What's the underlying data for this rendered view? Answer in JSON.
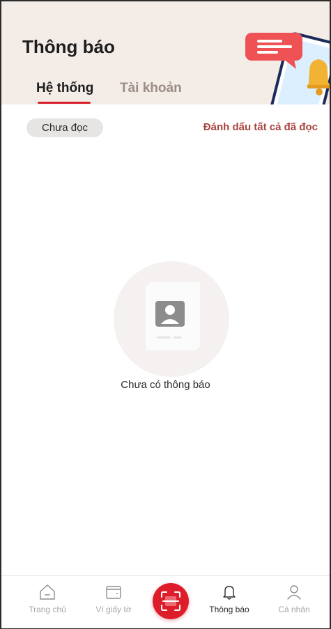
{
  "header": {
    "title": "Thông báo",
    "tabs": [
      {
        "label": "Hệ thống",
        "active": true
      },
      {
        "label": "Tài khoản",
        "active": false
      }
    ],
    "illustration_icons": [
      "chat-bubble-icon",
      "bell-icon"
    ]
  },
  "filter": {
    "unread_label": "Chưa đọc",
    "mark_all_label": "Đánh dấu tất cả đã đọc"
  },
  "empty_state": {
    "icon": "profile-card-icon",
    "message": "Chưa có thông báo"
  },
  "bottom_nav": {
    "items": [
      {
        "label": "Trang chủ",
        "icon": "home-icon"
      },
      {
        "label": "Ví giấy tờ",
        "icon": "wallet-icon"
      },
      {
        "label": "Thông báo",
        "icon": "bell-icon",
        "active": true
      },
      {
        "label": "Cá nhân",
        "icon": "user-icon"
      }
    ],
    "center_icon": "scan-icon"
  },
  "colors": {
    "accent": "#d8202c",
    "header_bg": "#f3ece7",
    "chip_bg": "#e7e5e3",
    "mark_all_text": "#a8433d"
  }
}
